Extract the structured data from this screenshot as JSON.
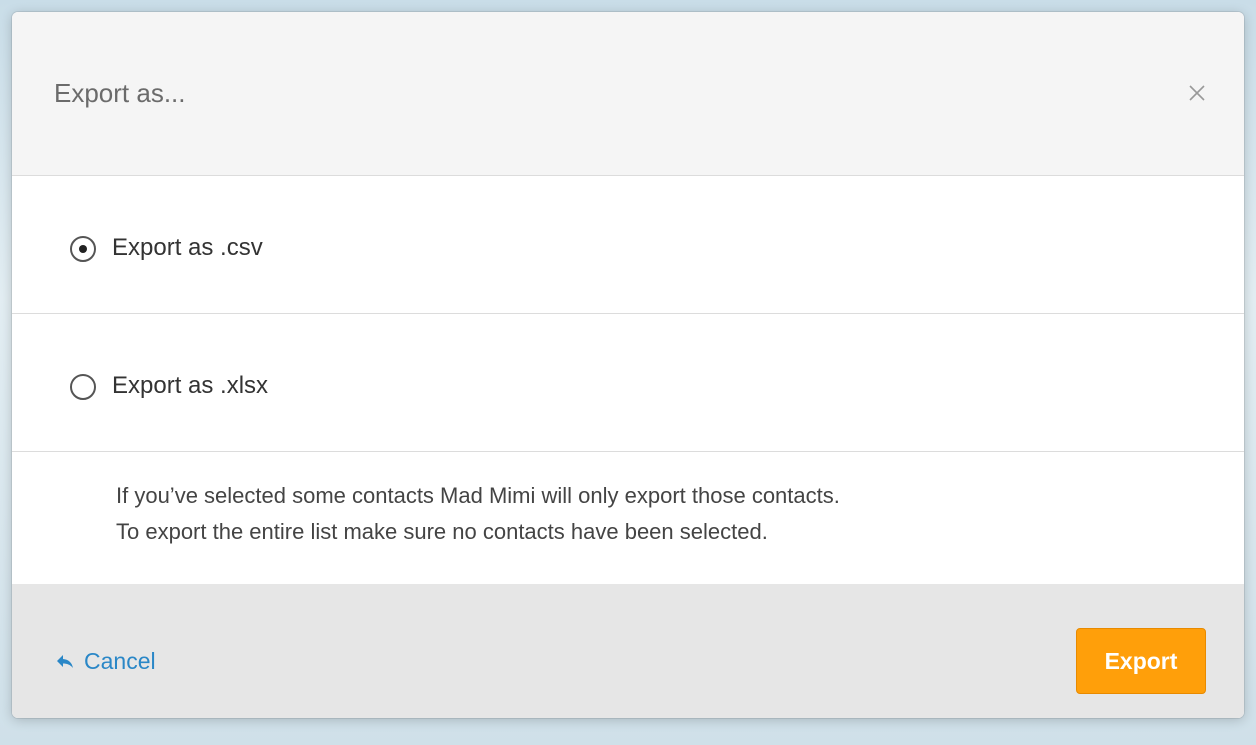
{
  "dialog": {
    "title": "Export as...",
    "close_icon": "close-icon"
  },
  "options": [
    {
      "label": "Export as .csv",
      "selected": true
    },
    {
      "label": "Export as .xlsx",
      "selected": false
    }
  ],
  "note": {
    "line1": "If you’ve selected some contacts Mad Mimi will only export those contacts.",
    "line2": "To export the entire list make sure no contacts have been selected."
  },
  "footer": {
    "cancel_label": "Cancel",
    "cancel_icon": "reply-arrow-icon",
    "export_label": "Export"
  },
  "colors": {
    "accent": "#ff9f0a",
    "link": "#2a87c7"
  }
}
